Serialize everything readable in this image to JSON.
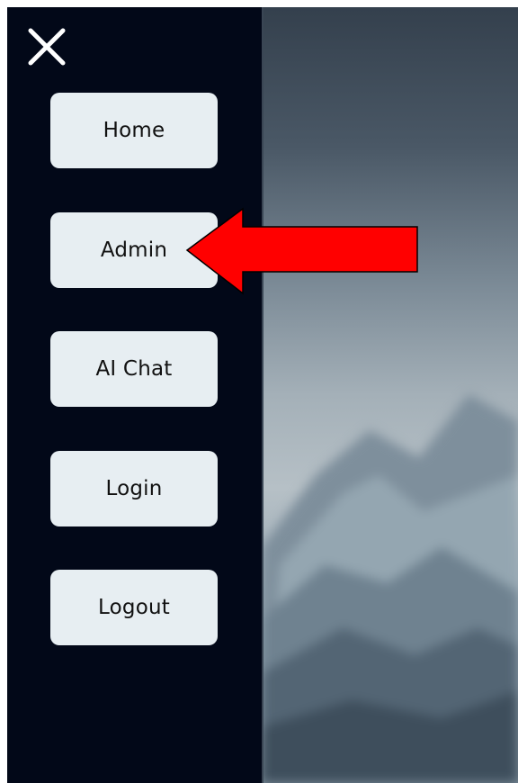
{
  "menu": {
    "items": [
      {
        "label": "Home"
      },
      {
        "label": "Admin"
      },
      {
        "label": "AI Chat"
      },
      {
        "label": "Login"
      },
      {
        "label": "Logout"
      }
    ]
  },
  "icons": {
    "close": "close-icon",
    "annotation": "red-arrow-pointer"
  },
  "colors": {
    "sidebar_bg": "#020818",
    "button_bg": "#e7eef2",
    "arrow": "#ff0000"
  }
}
